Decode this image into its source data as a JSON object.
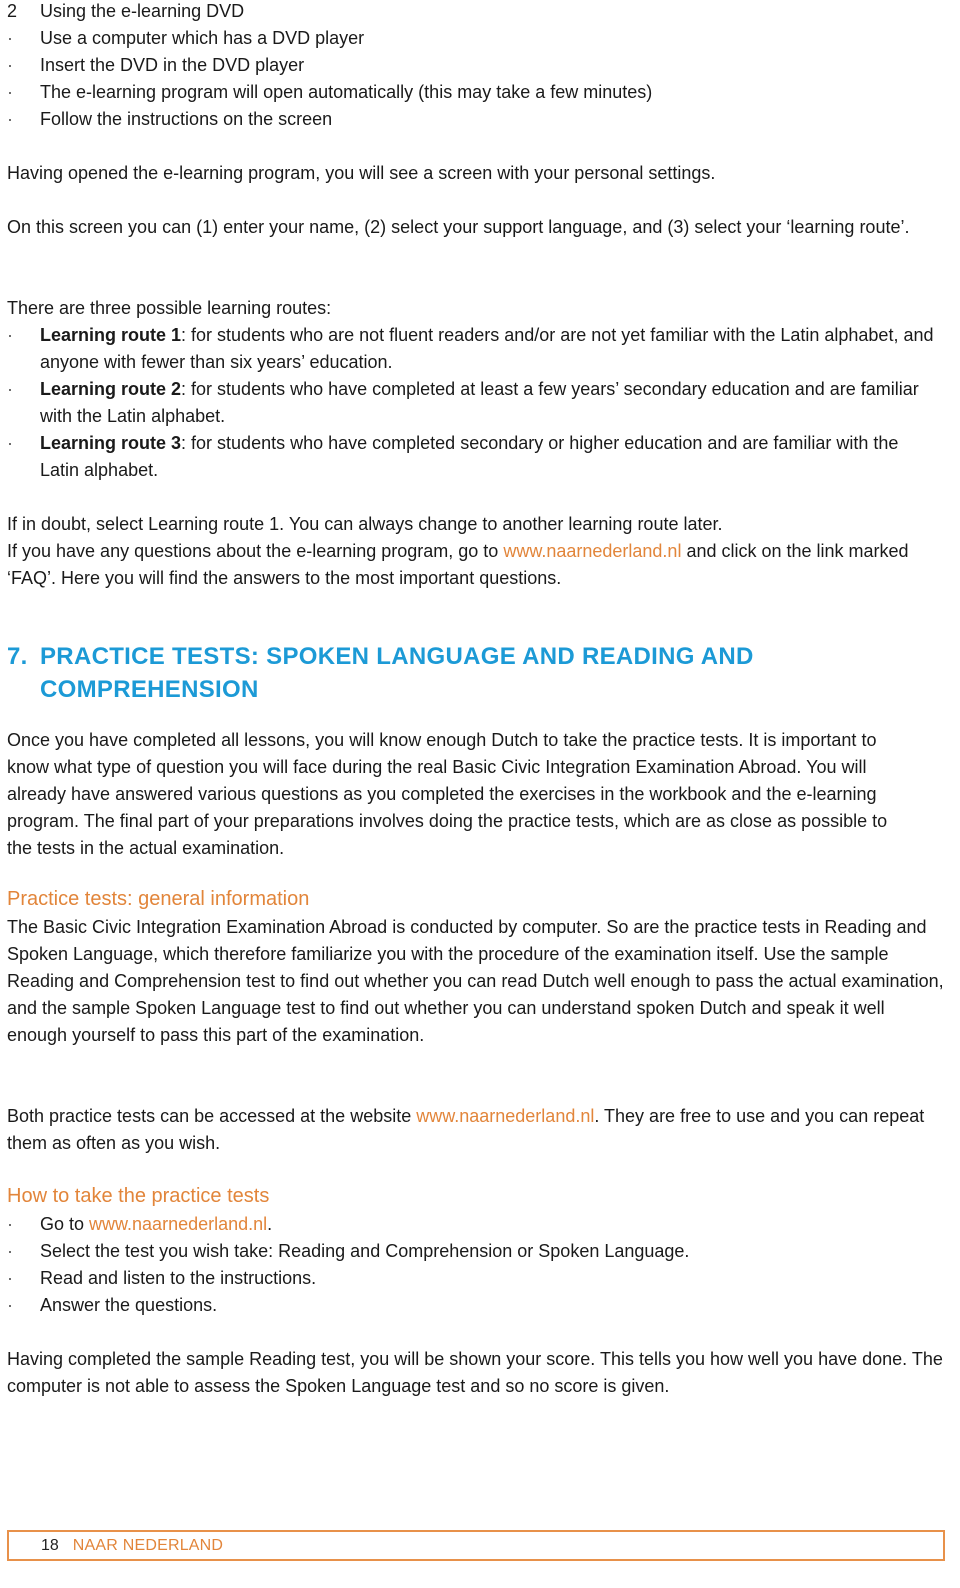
{
  "section2": {
    "number": "2",
    "title": "Using the e-learning DVD",
    "bullet_glyph": "·",
    "steps": [
      "Use a computer which has a DVD player",
      "Insert the DVD in the DVD player",
      "The e-learning program will open automatically (this may take a few minutes)",
      "Follow the instructions on the screen"
    ],
    "para1": "Having opened the e-learning program, you will see a screen with your personal settings.",
    "para2": "On this screen you can (1) enter your name, (2) select your support language, and (3) select your ‘learning route’.",
    "routes_intro": "There are three possible learning routes:",
    "routes": [
      {
        "label": "Learning route 1",
        "text": ": for students who are not fluent readers and/or are not yet familiar with the Latin alphabet, and anyone with fewer than six years’ education."
      },
      {
        "label": "Learning route 2",
        "text": ": for students who have completed at least a few years’ secondary education and are familiar with the Latin alphabet."
      },
      {
        "label": "Learning route 3",
        "text": ": for students who have completed secondary or higher education and are familiar with the Latin alphabet."
      }
    ],
    "doubt": "If in doubt, select Learning route 1. You can always change to another learning route later.",
    "faq_pre": "If you have any questions about the e-learning program, go to ",
    "faq_link": "www.naarnederland.nl",
    "faq_post": " and click on the link marked ‘FAQ’. Here you will find the answers to the most important questions."
  },
  "section7": {
    "number": "7.",
    "title": "PRACTICE TESTS: SPOKEN LANGUAGE AND READING AND COMPREHENSION",
    "intro": "Once you have completed all lessons, you will know enough Dutch to take the practice tests. It is important to know what type of question you will face during the real Basic Civic Integration Examination Abroad. You will already have answered various questions as you completed the exercises in the workbook and the e-learning program. The final part of your preparations involves doing the practice tests, which are as close as possible to the tests in the actual examination.",
    "general": {
      "heading": "Practice tests: general information",
      "text": "The Basic Civic Integration Examination Abroad is conducted by computer. So are the practice tests in Reading and Spoken Language, which therefore familiarize you with the procedure of the examination itself. Use the sample Reading and Comprehension test to find out whether you can read Dutch well enough to pass the actual examination, and the sample Spoken Language test to find out whether you can understand spoken Dutch and speak it well enough yourself to pass this part of the examination.",
      "access_pre": "Both practice tests can be accessed at the website ",
      "access_link": "www.naarnederland.nl",
      "access_post": ". They are free to use and you can repeat them as often as you wish."
    },
    "howto": {
      "heading": "How to take the practice tests",
      "step1_pre": "Go to ",
      "step1_link": "www.naarnederland.nl",
      "step1_post": ".",
      "steps": [
        "Select the test you wish take: Reading and Comprehension or Spoken Language.",
        "Read and listen to the instructions.",
        "Answer the questions."
      ]
    },
    "score": "Having completed the sample Reading test, you will be shown your score. This tells you how well you have done. The computer is not able to assess the Spoken Language test and so no score is given."
  },
  "footer": {
    "page_number": "18",
    "brand": "NAAR NEDERLAND"
  },
  "colors": {
    "heading_blue": "#1c9ad6",
    "accent_orange": "#e2853a",
    "text": "#1a1a1a"
  }
}
